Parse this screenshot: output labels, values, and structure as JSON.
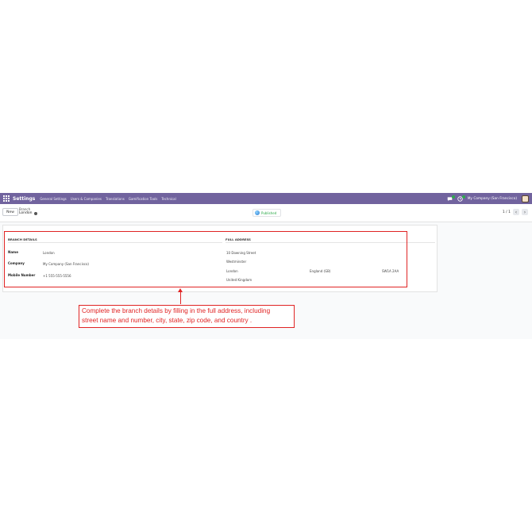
{
  "navbar": {
    "app_title": "Settings",
    "menu": [
      "General Settings",
      "Users & Companies",
      "Translations",
      "Gamification Tools",
      "Technical"
    ],
    "company": "My Company (San Francisco)"
  },
  "control": {
    "new_label": "New",
    "breadcrumb_parent": "Branch",
    "breadcrumb_current": "London",
    "status": "Published",
    "pager": "1 / 1"
  },
  "branch_details": {
    "title": "BRANCH DETAILS",
    "name_label": "Name",
    "name_value": "London",
    "company_label": "Company",
    "company_value": "My Company (San Francisco)",
    "mobile_label": "Mobile Number",
    "mobile_value": "+1 555-555-5556"
  },
  "full_address": {
    "title": "FULL ADDRESS",
    "street": "10 Downing Street",
    "street2": "Westminster",
    "city": "London",
    "state": "England (GB)",
    "zip": "SW1A 2AA",
    "country": "United Kingdom"
  },
  "annotation": {
    "line1": "Complete the branch details by filling in the full address, including",
    "line2": "street name and number, city, state, zip code, and country ."
  },
  "colors": {
    "navbar": "#71639e",
    "annotation": "#e02424",
    "published": "#28a745"
  }
}
